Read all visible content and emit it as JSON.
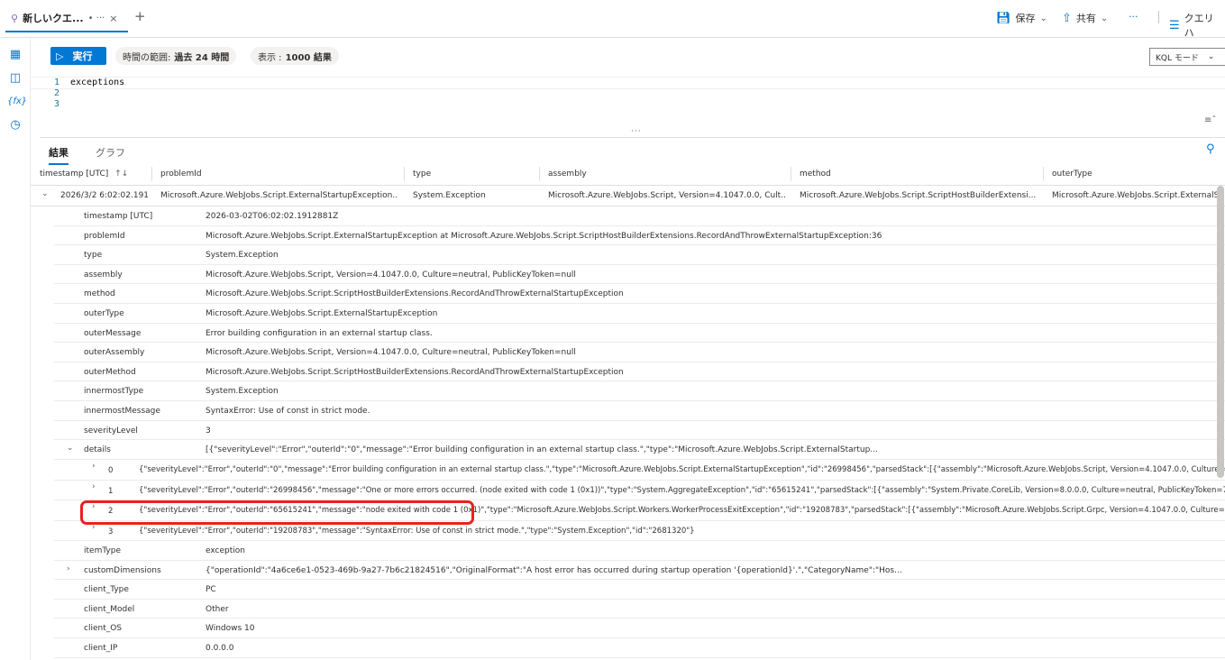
{
  "tabbar": {
    "tab_label": "新しいクエ...",
    "tab_modified": "• ···",
    "tab_close": "×",
    "add_tab": "+",
    "save_label": "保存",
    "share_label": "共有",
    "more_label": "···",
    "query_label": "クエリ ハ"
  },
  "toolbar": {
    "run_label": "実行",
    "time_range_prefix": "時間の範囲:",
    "time_range_value": "過去 24 時間",
    "show_prefix": "表示 :",
    "show_value": "1000 結果",
    "mode_label": "KQL モード"
  },
  "editor": {
    "lines": [
      {
        "num": "1",
        "code": "exceptions"
      },
      {
        "num": "2",
        "code": ""
      },
      {
        "num": "3",
        "code": ""
      }
    ],
    "splitter": "···"
  },
  "results_tabs": {
    "results": "結果",
    "chart": "グラフ"
  },
  "grid": {
    "headers": [
      "timestamp [UTC]",
      "problemId",
      "type",
      "assembly",
      "method",
      "outerType"
    ],
    "sort_indicator": "↑↓",
    "main_row": {
      "timestamp": "2026/3/2 6:02:02.191",
      "problemId": "Microsoft.Azure.WebJobs.Script.ExternalStartupException...",
      "type": "System.Exception",
      "assembly": "Microsoft.Azure.WebJobs.Script, Version=4.1047.0.0, Cult...",
      "method": "Microsoft.Azure.WebJobs.Script.ScriptHostBuilderExtensi...",
      "outerType": "Microsoft.Azure.WebJobs.Script.ExternalSt"
    },
    "details": [
      {
        "key": "timestamp [UTC]",
        "value": "2026-03-02T06:02:02.1912881Z"
      },
      {
        "key": "problemId",
        "value": "Microsoft.Azure.WebJobs.Script.ExternalStartupException at Microsoft.Azure.WebJobs.Script.ScriptHostBuilderExtensions.RecordAndThrowExternalStartupException:36"
      },
      {
        "key": "type",
        "value": "System.Exception"
      },
      {
        "key": "assembly",
        "value": "Microsoft.Azure.WebJobs.Script, Version=4.1047.0.0, Culture=neutral, PublicKeyToken=null"
      },
      {
        "key": "method",
        "value": "Microsoft.Azure.WebJobs.Script.ScriptHostBuilderExtensions.RecordAndThrowExternalStartupException"
      },
      {
        "key": "outerType",
        "value": "Microsoft.Azure.WebJobs.Script.ExternalStartupException"
      },
      {
        "key": "outerMessage",
        "value": "Error building configuration in an external startup class."
      },
      {
        "key": "outerAssembly",
        "value": "Microsoft.Azure.WebJobs.Script, Version=4.1047.0.0, Culture=neutral, PublicKeyToken=null"
      },
      {
        "key": "outerMethod",
        "value": "Microsoft.Azure.WebJobs.Script.ScriptHostBuilderExtensions.RecordAndThrowExternalStartupException"
      },
      {
        "key": "innermostType",
        "value": "System.Exception"
      },
      {
        "key": "innermostMessage",
        "value": "SyntaxError: Use of const in strict mode."
      },
      {
        "key": "severityLevel",
        "value": "3"
      },
      {
        "key": "details",
        "value": "[{\"severityLevel\":\"Error\",\"outerId\":\"0\",\"message\":\"Error building configuration in an external startup class.\",\"type\":\"Microsoft.Azure.WebJobs.Script.ExternalStartup..."
      }
    ],
    "details_sub": [
      {
        "idx": "0",
        "value": "{\"severityLevel\":\"Error\",\"outerId\":\"0\",\"message\":\"Error building configuration in an external startup class.\",\"type\":\"Microsoft.Azure.WebJobs.Script.ExternalStartupException\",\"id\":\"26998456\",\"parsedStack\":[{\"assembly\":\"Microsoft.Azure.WebJobs.Script, Version=4.1047.0.0, Culture=neutral"
      },
      {
        "idx": "1",
        "value": "{\"severityLevel\":\"Error\",\"outerId\":\"26998456\",\"message\":\"One or more errors occurred. (node exited with code 1 (0x1))\",\"type\":\"System.AggregateException\",\"id\":\"65615241\",\"parsedStack\":[{\"assembly\":\"System.Private.CoreLib, Version=8.0.0.0, Culture=neutral, PublicKeyToken=7cec85d7"
      },
      {
        "idx": "2",
        "value": "{\"severityLevel\":\"Error\",\"outerId\":\"65615241\",\"message\":\"node exited with code 1 (0x1)\",\"type\":\"Microsoft.Azure.WebJobs.Script.Workers.WorkerProcessExitException\",\"id\":\"19208783\",\"parsedStack\":[{\"assembly\":\"Microsoft.Azure.WebJobs.Script.Grpc, Version=4.1047.0.0, Culture=neutral"
      },
      {
        "idx": "3",
        "value": "{\"severityLevel\":\"Error\",\"outerId\":\"19208783\",\"message\":\"SyntaxError: Use of const in strict mode.\",\"type\":\"System.Exception\",\"id\":\"2681320\"}"
      }
    ],
    "after": [
      {
        "key": "itemType",
        "value": "exception"
      },
      {
        "key": "customDimensions",
        "value": "{\"operationId\":\"4a6ce6e1-0523-469b-9a27-7b6c21824516\",\"OriginalFormat\":\"A host error has occurred during startup operation '{operationId}'.\",\"CategoryName\":\"Hos..."
      },
      {
        "key": "client_Type",
        "value": "PC"
      },
      {
        "key": "client_Model",
        "value": "Other"
      },
      {
        "key": "client_OS",
        "value": "Windows 10"
      },
      {
        "key": "client_IP",
        "value": "0.0.0.0"
      }
    ]
  }
}
